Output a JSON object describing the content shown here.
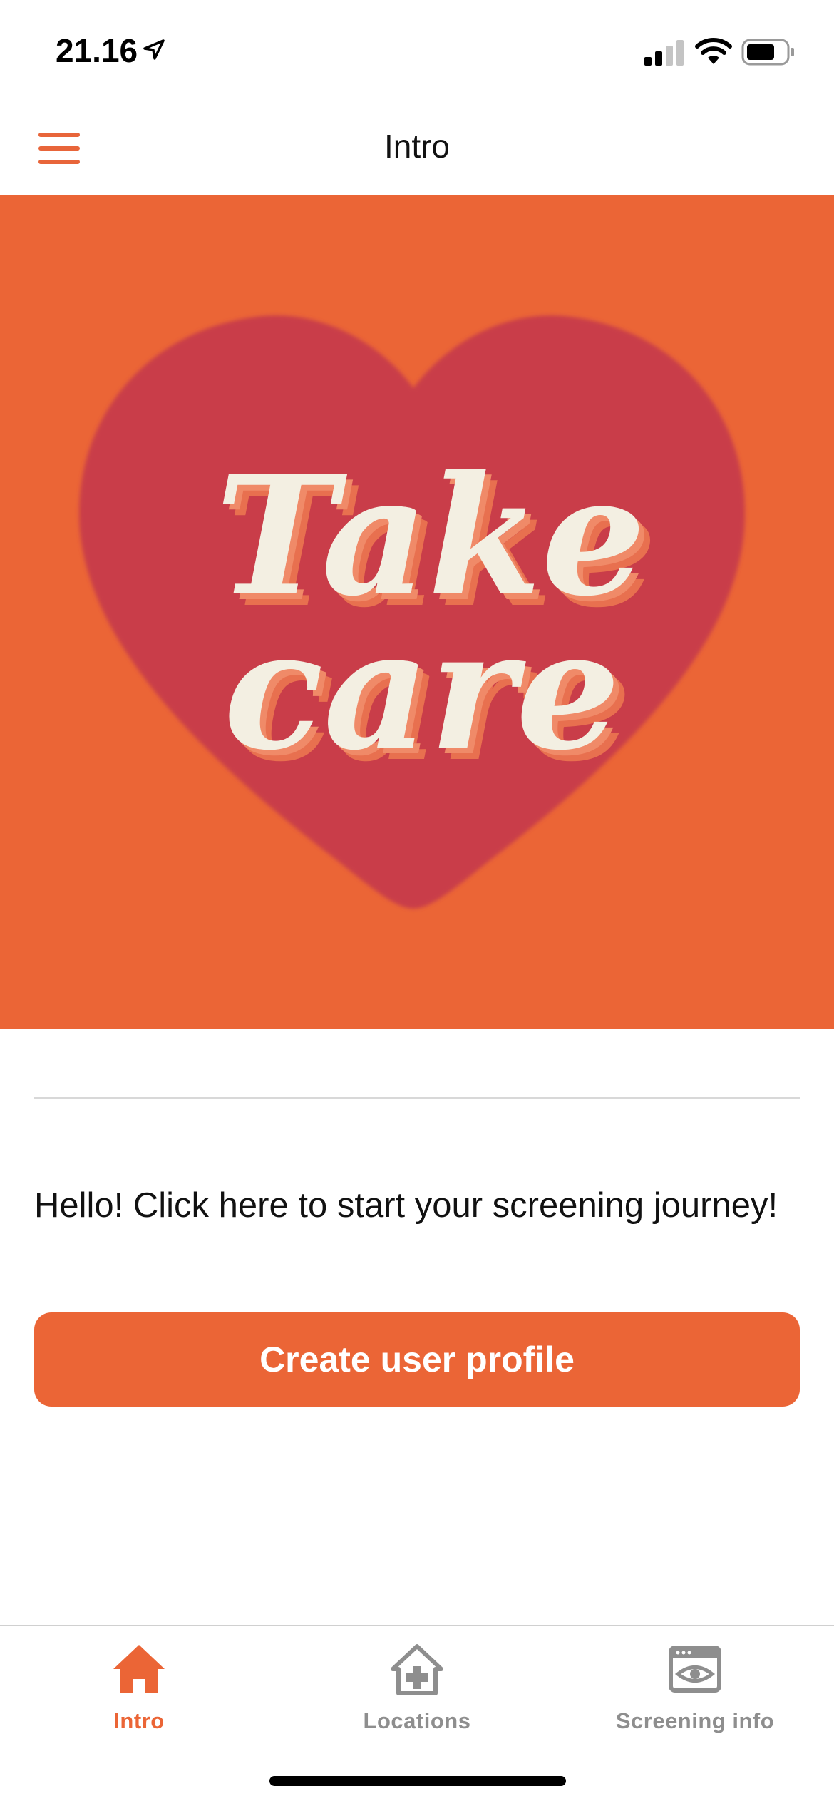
{
  "status_bar": {
    "time": "21.16",
    "location_icon": "location-arrow-icon",
    "signal_icon": "cellular-signal-icon",
    "wifi_icon": "wifi-icon",
    "battery_icon": "battery-icon"
  },
  "nav": {
    "title": "Intro",
    "menu_icon": "hamburger-menu-icon"
  },
  "hero": {
    "image_text_line1": "Take",
    "image_text_line2": "care"
  },
  "content": {
    "intro_text": "Hello! Click here to start your screening journey!",
    "create_button_label": "Create user profile"
  },
  "tabs": [
    {
      "label": "Intro",
      "icon": "home-icon",
      "active": true
    },
    {
      "label": "Locations",
      "icon": "hospital-icon",
      "active": false
    },
    {
      "label": "Screening info",
      "icon": "eye-window-icon",
      "active": false
    }
  ],
  "colors": {
    "accent": "#eb6536",
    "heart": "#c93d4a",
    "hero_text": "#f3efe2",
    "inactive_tab": "#8e8e8e"
  }
}
